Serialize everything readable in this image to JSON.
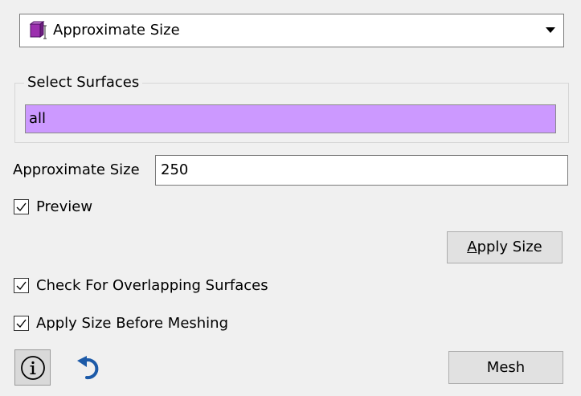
{
  "mode_selector": {
    "selected": "Approximate Size",
    "icon": "cube-size-icon"
  },
  "select_surfaces": {
    "legend": "Select Surfaces",
    "value": "all",
    "highlight_color": "#cc99ff"
  },
  "approximate_size": {
    "label": "Approximate Size",
    "value": "250"
  },
  "preview": {
    "label": "Preview",
    "checked": true
  },
  "apply_size_button": {
    "label_mnemonic": "A",
    "label_rest": "pply Size"
  },
  "check_overlapping": {
    "label": "Check For Overlapping Surfaces",
    "checked": true
  },
  "apply_before_meshing": {
    "label": "Apply Size Before Meshing",
    "checked": true
  },
  "footer": {
    "info_icon": "info-icon",
    "undo_icon": "undo-icon",
    "mesh_label": "Mesh"
  },
  "colors": {
    "accent_blue": "#1c5aa8",
    "icon_purple": "#9b2fae"
  }
}
